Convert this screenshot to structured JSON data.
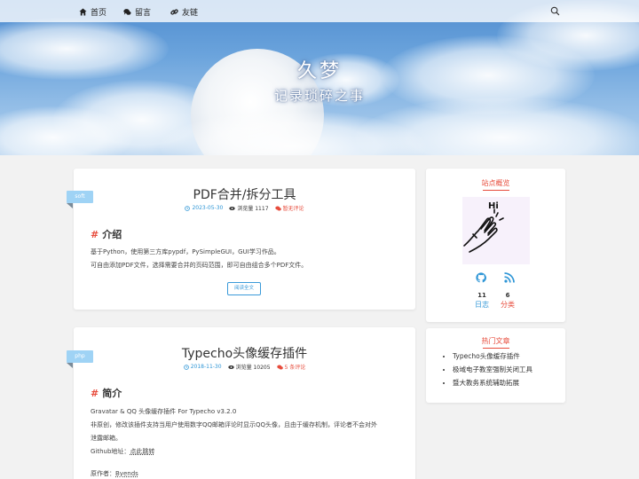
{
  "nav": {
    "items": [
      {
        "label": "首页",
        "icon": "home-icon"
      },
      {
        "label": "留言",
        "icon": "comments-icon"
      },
      {
        "label": "友链",
        "icon": "link-icon"
      }
    ],
    "search_icon": "search-icon"
  },
  "hero": {
    "title": "久梦",
    "subtitle": "记录琐碎之事"
  },
  "posts": [
    {
      "tag": "soft",
      "title": "PDF合并/拆分工具",
      "date": "2023-05-30",
      "views": "浏览量 1117",
      "comments": "暂无评论",
      "section": "介绍",
      "lines": [
        "基于Python，使用第三方库pypdf，PySimpleGUI，GUI学习作品。",
        "可自由添加PDF文件，选择需要合并的页码范围，即可自由组合多个PDF文件。"
      ],
      "read_more": "阅读全文"
    },
    {
      "tag": "php",
      "title": "Typecho头像缓存插件",
      "date": "2018-11-30",
      "views": "浏览量 10205",
      "comments": "5 条评论",
      "section": "简介",
      "lines": [
        "Gravatar & QQ 头像缓存插件 For Typecho v3.2.0",
        "非原创，修改该插件支持当用户使用数字QQ邮箱评论时显示QQ头像，且由于缓存机制，评论者不会对外",
        "泄露邮箱。"
      ],
      "github_prefix": "Github地址：",
      "github_link": "点此跳转",
      "author_prefix": "原作者：",
      "author_link": "Byends"
    }
  ],
  "sidebar": {
    "overview": {
      "heading": "站点概览",
      "hi_text": "Hi",
      "logs_count": "11",
      "logs_label": "日志",
      "categories_count": "6",
      "categories_label": "分类",
      "icons": [
        "github-icon",
        "rss-icon"
      ]
    },
    "hot": {
      "heading": "热门文章",
      "items": [
        "Typecho头像缓存插件",
        "极域电子教室强制关闭工具",
        "暨大教务系统辅助拓展"
      ]
    }
  },
  "colors": {
    "accent_red": "#e74c3c",
    "accent_blue": "#2f96d6",
    "tag_blue": "#9fd3f5",
    "background": "#f2f2f2"
  }
}
